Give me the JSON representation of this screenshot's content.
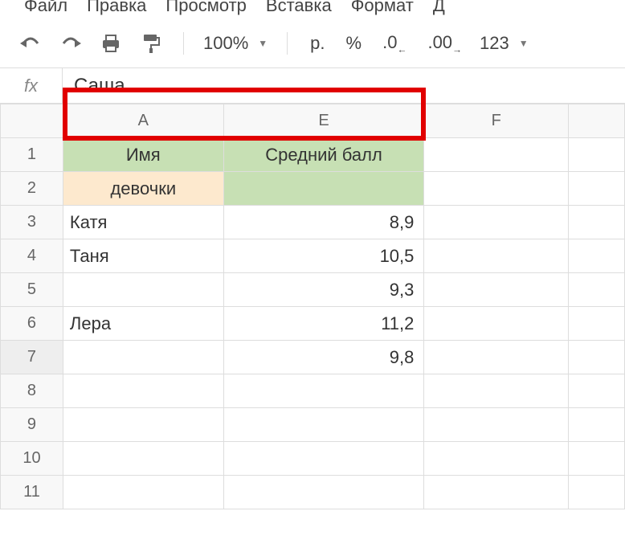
{
  "menu": {
    "file": "Файл",
    "edit": "Правка",
    "view": "Просмотр",
    "insert": "Вставка",
    "format": "Формат",
    "data_cut": "Д"
  },
  "toolbar": {
    "zoom": "100%",
    "currency": "р.",
    "percent": "%",
    "dec_less": ".0",
    "dec_more": ".00",
    "num_format": "123"
  },
  "fx": {
    "label": "fx",
    "value": "Саша"
  },
  "columns": [
    "A",
    "E",
    "F",
    ""
  ],
  "rows": [
    "1",
    "2",
    "3",
    "4",
    "5",
    "6",
    "7",
    "8",
    "9",
    "10",
    "11"
  ],
  "cells": {
    "header_name": "Имя",
    "header_avg": "Средний балл",
    "sub_girls": "девочки",
    "r3_a": "Катя",
    "r3_e": "8,9",
    "r4_a": "Таня",
    "r4_e": "10,5",
    "r5_a": "",
    "r5_e": "9,3",
    "r6_a": "Лера",
    "r6_e": "11,2",
    "r7_a": "",
    "r7_e": "9,8"
  }
}
